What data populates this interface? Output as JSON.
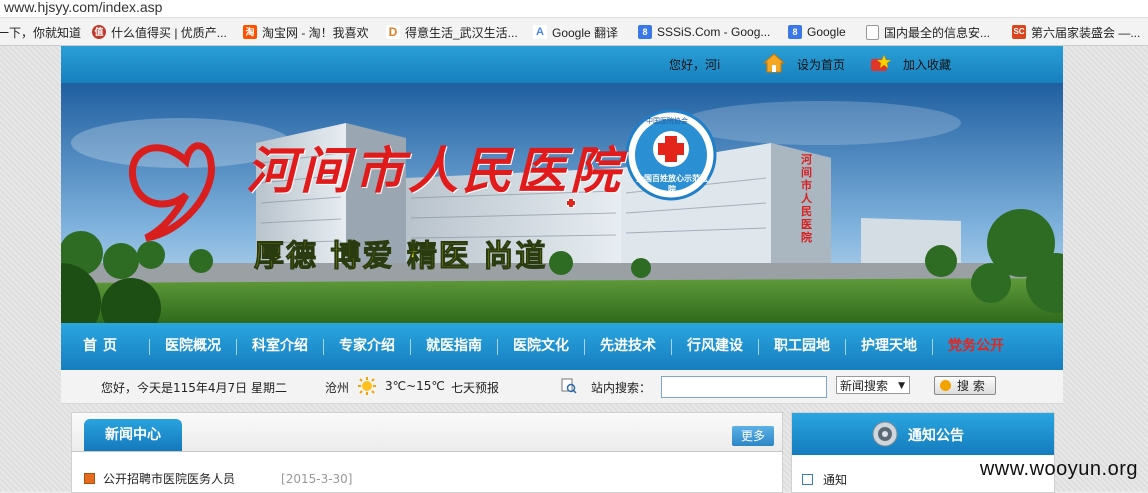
{
  "browser": {
    "url": "www.hjsyy.com/index.asp",
    "bookmarks": [
      {
        "label": "一下，你就知道",
        "icon": "none",
        "color": ""
      },
      {
        "label": "什么值得买 | 优质产...",
        "icon": "smzdm-icon",
        "color": "#c0392b"
      },
      {
        "label": "淘宝网 - 淘！我喜欢",
        "icon": "taobao-icon",
        "color": "#ff5000"
      },
      {
        "label": "得意生活_武汉生活...",
        "icon": "deyi-icon",
        "color": "#e67e22"
      },
      {
        "label": "Google 翻译",
        "icon": "google-translate-icon",
        "color": "#4a86e8"
      },
      {
        "label": "SSSiS.Com - Goog...",
        "icon": "google-icon",
        "color": "#3b78e7"
      },
      {
        "label": "Google",
        "icon": "google-icon",
        "color": "#3b78e7"
      },
      {
        "label": "国内最全的信息安...",
        "icon": "page-icon",
        "color": "#888888"
      },
      {
        "label": "第六届家装盛会 —...",
        "icon": "sc-icon",
        "color": "#d9461e"
      }
    ]
  },
  "topbar": {
    "greeting": "您好，河i",
    "set_home": "设为首页",
    "add_favorite": "加入收藏"
  },
  "banner": {
    "hospital_name": "河间市人民医院",
    "motto": "厚德 博爱 精医 尚道",
    "emblem_text": "全国百姓放心示范医院",
    "emblem_top": "中国医院协会",
    "vertical_sign": "河间市人民医院"
  },
  "nav": {
    "items": [
      {
        "label": "首页",
        "highlight": false
      },
      {
        "label": "医院概况",
        "highlight": false
      },
      {
        "label": "科室介绍",
        "highlight": false
      },
      {
        "label": "专家介绍",
        "highlight": false
      },
      {
        "label": "就医指南",
        "highlight": false
      },
      {
        "label": "医院文化",
        "highlight": false
      },
      {
        "label": "先进技术",
        "highlight": false
      },
      {
        "label": "行风建设",
        "highlight": false
      },
      {
        "label": "职工园地",
        "highlight": false
      },
      {
        "label": "护理天地",
        "highlight": false
      },
      {
        "label": "党务公开",
        "highlight": true
      }
    ]
  },
  "infobar": {
    "date_text": "您好，今天是115年4月7日 星期二",
    "city": "沧州",
    "temperature": "3℃~15℃",
    "forecast": "七天预报",
    "search_label": "站内搜索：",
    "search_value": "",
    "search_type": "新闻搜索",
    "search_button": "搜 索"
  },
  "news": {
    "title": "新闻中心",
    "more": "更多",
    "items": [
      {
        "title": "公开招聘市医院医务人员",
        "date": "[2015-3-30]"
      }
    ]
  },
  "notice": {
    "title": "通知公告",
    "items": [
      {
        "title": "通知"
      }
    ]
  },
  "watermark": "www.wooyun.org",
  "colors": {
    "nav_blue": "#1e90d0",
    "highlight_red": "#e9241b"
  }
}
